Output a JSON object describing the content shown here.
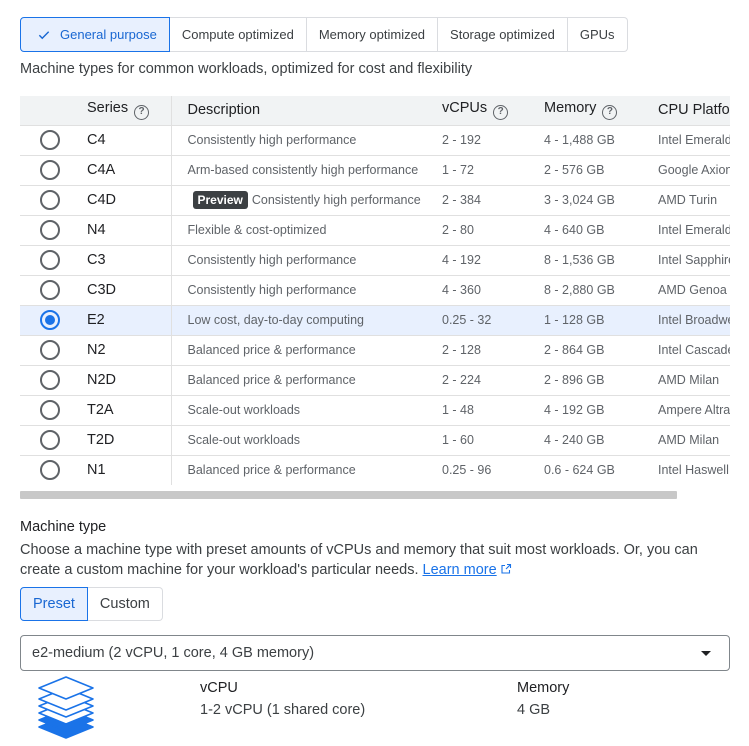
{
  "tabs": [
    {
      "label": "General purpose",
      "active": true
    },
    {
      "label": "Compute optimized",
      "active": false
    },
    {
      "label": "Memory optimized",
      "active": false
    },
    {
      "label": "Storage optimized",
      "active": false
    },
    {
      "label": "GPUs",
      "active": false
    }
  ],
  "subtitle": "Machine types for common workloads, optimized for cost and flexibility",
  "table": {
    "headers": {
      "series": "Series",
      "description": "Description",
      "vcpus": "vCPUs",
      "memory": "Memory",
      "cpu_platform": "CPU Platfor"
    },
    "rows": [
      {
        "series": "C4",
        "badge": "",
        "description": "Consistently high performance",
        "vcpus": "2 - 192",
        "memory": "4 - 1,488 GB",
        "cpu": "Intel Emerald"
      },
      {
        "series": "C4A",
        "badge": "",
        "description": "Arm-based consistently high performance",
        "vcpus": "1 - 72",
        "memory": "2 - 576 GB",
        "cpu": "Google Axion"
      },
      {
        "series": "C4D",
        "badge": "Preview",
        "description": "Consistently high performance",
        "vcpus": "2 - 384",
        "memory": "3 - 3,024 GB",
        "cpu": "AMD Turin"
      },
      {
        "series": "N4",
        "badge": "",
        "description": "Flexible & cost-optimized",
        "vcpus": "2 - 80",
        "memory": "4 - 640 GB",
        "cpu": "Intel Emerald"
      },
      {
        "series": "C3",
        "badge": "",
        "description": "Consistently high performance",
        "vcpus": "4 - 192",
        "memory": "8 - 1,536 GB",
        "cpu": "Intel Sapphire"
      },
      {
        "series": "C3D",
        "badge": "",
        "description": "Consistently high performance",
        "vcpus": "4 - 360",
        "memory": "8 - 2,880 GB",
        "cpu": "AMD Genoa"
      },
      {
        "series": "E2",
        "badge": "",
        "description": "Low cost, day-to-day computing",
        "vcpus": "0.25 - 32",
        "memory": "1 - 128 GB",
        "cpu": "Intel Broadwe",
        "selected": true
      },
      {
        "series": "N2",
        "badge": "",
        "description": "Balanced price & performance",
        "vcpus": "2 - 128",
        "memory": "2 - 864 GB",
        "cpu": "Intel Cascade"
      },
      {
        "series": "N2D",
        "badge": "",
        "description": "Balanced price & performance",
        "vcpus": "2 - 224",
        "memory": "2 - 896 GB",
        "cpu": "AMD Milan"
      },
      {
        "series": "T2A",
        "badge": "",
        "description": "Scale-out workloads",
        "vcpus": "1 - 48",
        "memory": "4 - 192 GB",
        "cpu": "Ampere Altra"
      },
      {
        "series": "T2D",
        "badge": "",
        "description": "Scale-out workloads",
        "vcpus": "1 - 60",
        "memory": "4 - 240 GB",
        "cpu": "AMD Milan"
      },
      {
        "series": "N1",
        "badge": "",
        "description": "Balanced price & performance",
        "vcpus": "0.25 - 96",
        "memory": "0.6 - 624 GB",
        "cpu": "Intel Haswell"
      }
    ]
  },
  "machine_type": {
    "title": "Machine type",
    "description": "Choose a machine type with preset amounts of vCPUs and memory that suit most workloads. Or, you can create a custom machine for your workload's particular needs.",
    "learn_more": "Learn more",
    "preset_label": "Preset",
    "custom_label": "Custom",
    "selected_value": "e2-medium (2 vCPU, 1 core, 4 GB memory)",
    "vcpu_label": "vCPU",
    "vcpu_value": "1-2 vCPU (1 shared core)",
    "memory_label": "Memory",
    "memory_value": "4 GB"
  },
  "icons": {
    "tab_check": "check-icon",
    "help": "help-circle-icon",
    "external": "external-link-icon",
    "dropdown": "arrow-drop-down-icon",
    "stack": "layers-stack-icon"
  },
  "colors": {
    "accent": "#1a73e8",
    "selected_bg": "#e8f0fe",
    "badge_bg": "#3c4043"
  }
}
